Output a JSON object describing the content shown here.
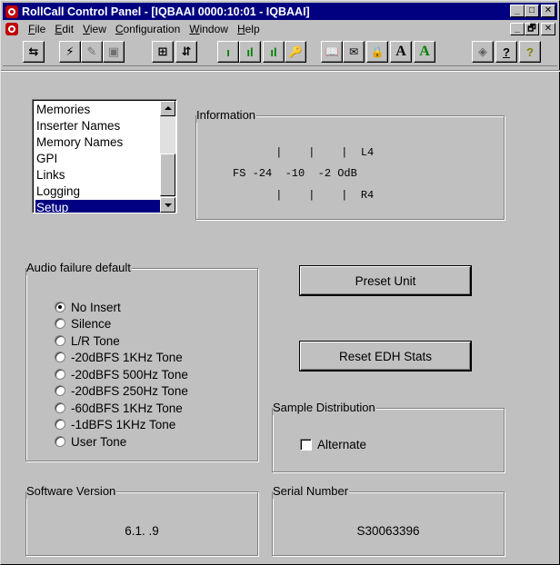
{
  "window": {
    "title": "RollCall Control Panel - [IQBAAI 0000:10:01 - IQBAAI]",
    "title_buttons": [
      "_",
      "□",
      "✕"
    ],
    "mdi_buttons": [
      "_",
      "🗗",
      "✕"
    ]
  },
  "menu": {
    "items": [
      {
        "underline": "F",
        "rest": "ile"
      },
      {
        "underline": "E",
        "rest": "dit"
      },
      {
        "underline": "V",
        "rest": "iew"
      },
      {
        "underline": "C",
        "rest": "onfiguration"
      },
      {
        "underline": "W",
        "rest": "indow"
      },
      {
        "underline": "H",
        "rest": "elp"
      }
    ]
  },
  "toolbar": {
    "icons": [
      "connect-icon",
      "lightning-icon",
      "edit-icon",
      "save-icon",
      "network-icon",
      "transfer-icon",
      "signal-low-icon",
      "signal-mid-icon",
      "signal-high-icon",
      "key-icon",
      "book-icon",
      "notes-icon",
      "lock-icon",
      "font-a-icon",
      "font-a-green-icon",
      "eraser-icon",
      "help-dialog-icon",
      "whats-this-icon"
    ],
    "glyphs": [
      "⇆",
      "⚡",
      "✎",
      "▣",
      "⊞",
      "⇵",
      "ı",
      "ıl",
      "ıl",
      "🔑",
      "📖",
      "✉",
      "🔒",
      "A",
      "A",
      "◈",
      "?",
      "?"
    ]
  },
  "nav_list": {
    "items": [
      "Memories",
      "Inserter Names",
      "Memory Names",
      "GPI",
      "Links",
      "Logging",
      "Setup"
    ],
    "selected": "Setup"
  },
  "information": {
    "label": "Information",
    "row1": "      |    |    |  L4",
    "row2": "FS -24  -10  -2 OdB",
    "row3": "      |    |    |  R4"
  },
  "audio_failure": {
    "label": "Audio failure default",
    "selected": "No Insert",
    "options": [
      "No Insert",
      "Silence",
      "L/R Tone",
      "-20dBFS 1KHz Tone",
      "-20dBFS 500Hz Tone",
      "-20dBFS 250Hz Tone",
      "-60dBFS 1KHz Tone",
      "-1dBFS 1KHz Tone",
      "User Tone"
    ]
  },
  "buttons": {
    "preset_unit": "Preset Unit",
    "reset_edh": "Reset EDH Stats"
  },
  "sample_distribution": {
    "label": "Sample Distribution",
    "checkbox_label": "Alternate",
    "checked": false
  },
  "software_version": {
    "label": "Software Version",
    "value": "6.1. .9"
  },
  "serial_number": {
    "label": "Serial Number",
    "value": "S30063396"
  }
}
